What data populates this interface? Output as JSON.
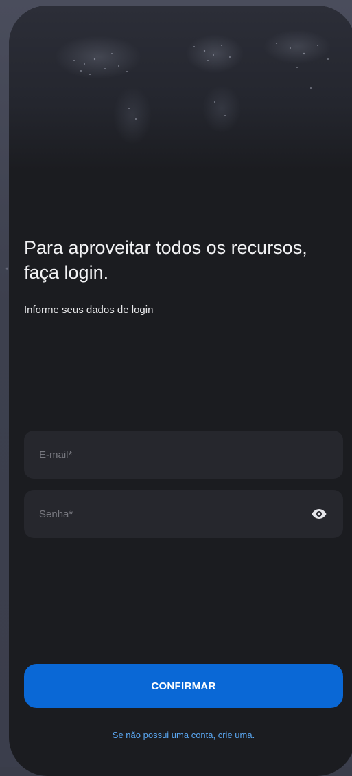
{
  "login": {
    "heading": "Para aproveitar todos os recursos, faça login.",
    "subheading": "Informe seus dados de login",
    "email_placeholder": "E-mail*",
    "email_value": "",
    "password_placeholder": "Senha*",
    "password_value": "",
    "password_toggle_icon": "eye-icon",
    "confirm_label": "CONFIRMAR",
    "signup_link": "Se não possui uma conta, crie uma."
  },
  "colors": {
    "background": "#1b1c20",
    "field": "#26272d",
    "primary_button": "#0a68d6",
    "link": "#5aa6f0",
    "text": "#f2f2f4"
  }
}
